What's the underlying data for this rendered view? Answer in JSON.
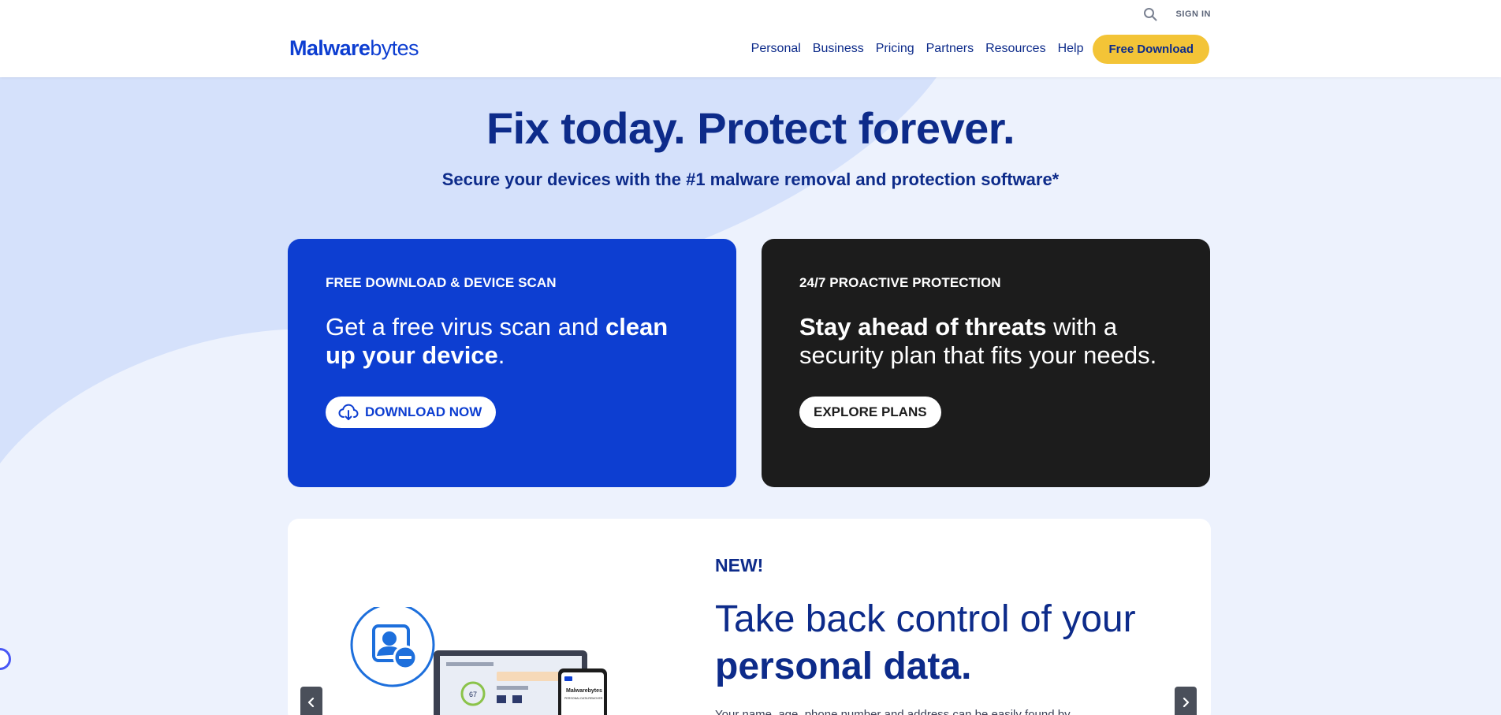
{
  "header": {
    "logo": {
      "bold": "Malware",
      "rest": "bytes"
    },
    "sign_in": "SIGN IN",
    "nav": [
      "Personal",
      "Business",
      "Pricing",
      "Partners",
      "Resources",
      "Help"
    ],
    "cta": "Free Download"
  },
  "hero": {
    "title": "Fix today. Protect forever.",
    "subtitle": "Secure your devices with the #1 malware removal and protection software*"
  },
  "cards": [
    {
      "eyebrow": "FREE DOWNLOAD & DEVICE SCAN",
      "body_plain": "Get a free virus scan and ",
      "body_bold": "clean up your device",
      "body_end": ".",
      "button": "DOWNLOAD NOW"
    },
    {
      "eyebrow": "24/7 PROACTIVE PROTECTION",
      "body_bold": "Stay ahead of threats",
      "body_plain": " with a security plan that fits your needs.",
      "button": "EXPLORE PLANS"
    }
  ],
  "feature": {
    "eyebrow": "NEW!",
    "title_plain": "Take back control of your",
    "title_bold": "personal data.",
    "desc": "Your name, age, phone number and address can be easily found by",
    "illustration": {
      "app_logo": "Malwarebytes",
      "panel_title": "PERSONAL DATA REMOVER",
      "score": "67"
    }
  },
  "colors": {
    "brand_blue": "#0d3ed1",
    "navy": "#0d2b8a",
    "cta_yellow": "#f3c437",
    "dark_card": "#1c1c1c",
    "page_bg": "#edf2fd"
  },
  "icons": {
    "search": "search-icon",
    "download": "cloud-download-icon",
    "prev": "chevron-left-icon",
    "next": "chevron-right-icon"
  }
}
